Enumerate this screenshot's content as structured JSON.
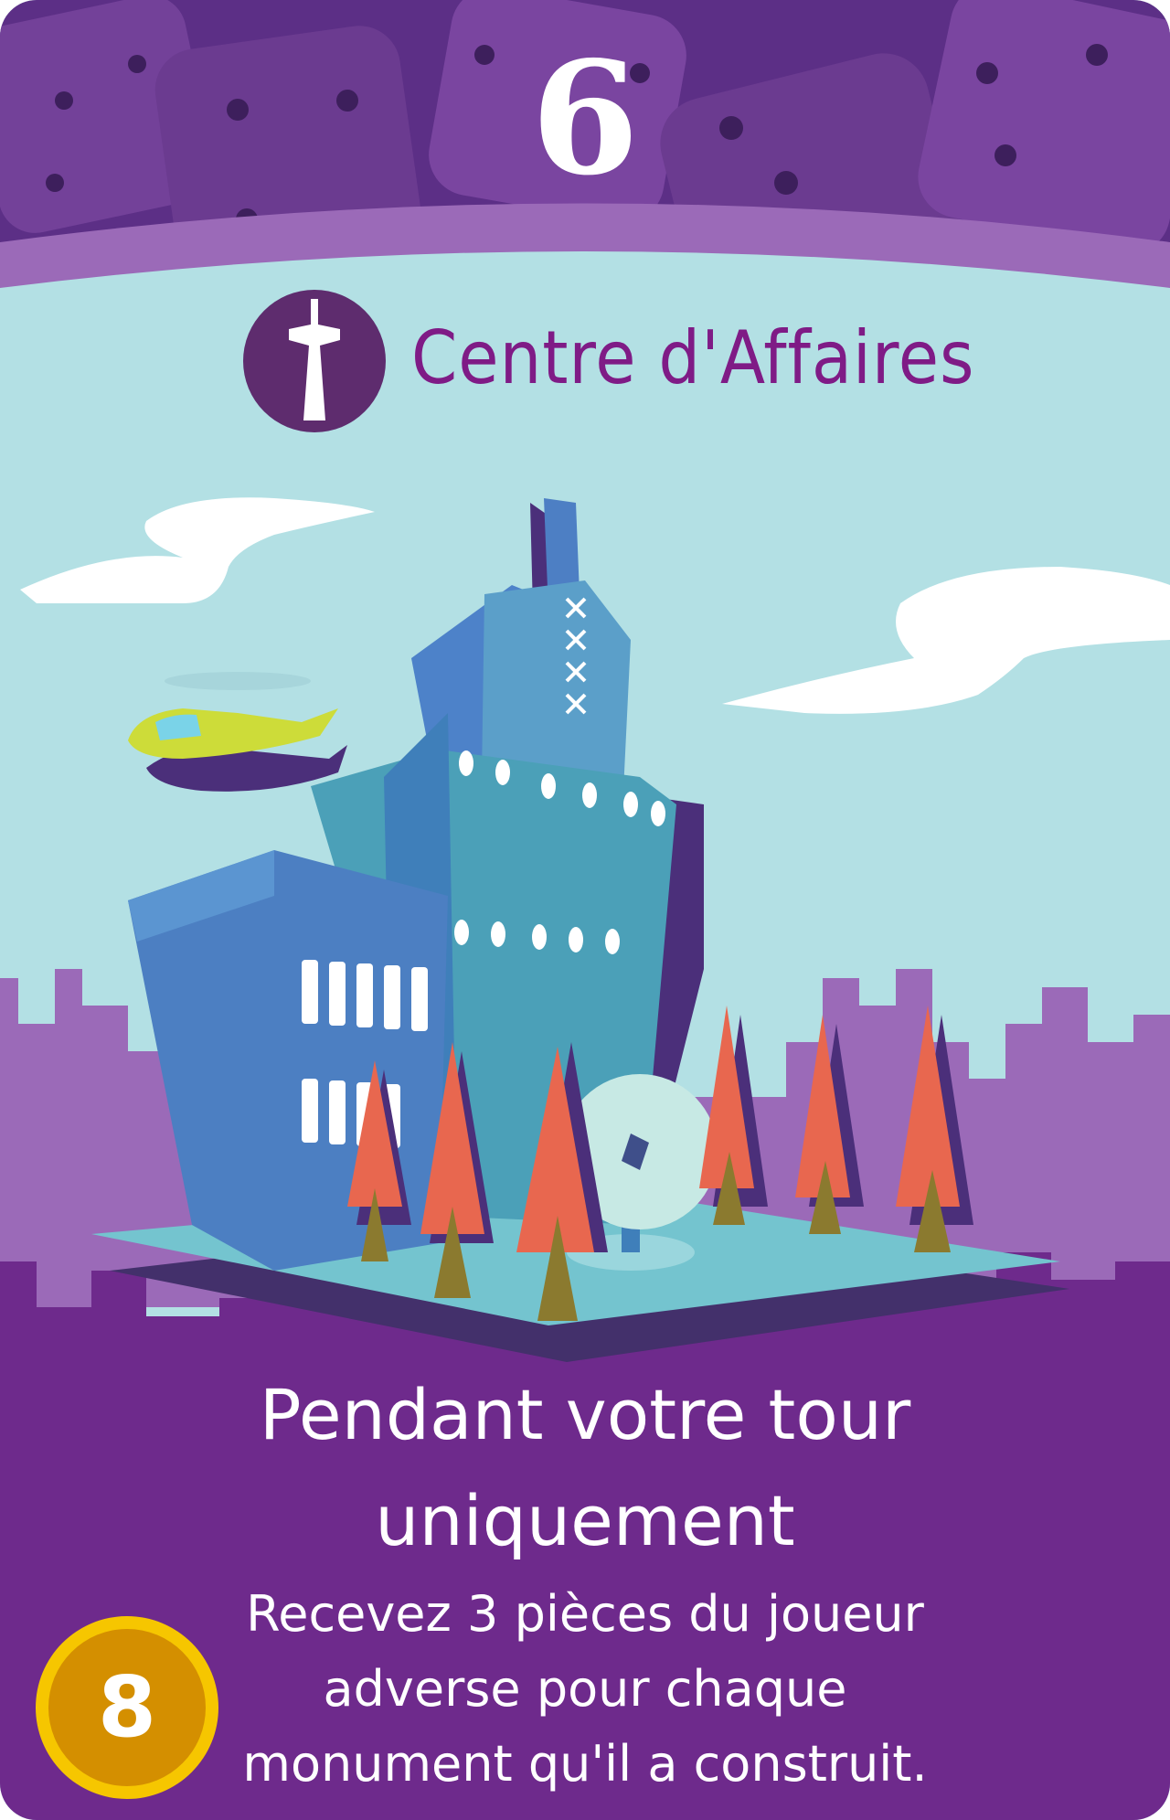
{
  "card": {
    "activation_number": "6",
    "name": "Centre d'Affaires",
    "icon": "tower-icon",
    "rule_title": "Pendant votre tour uniquement",
    "rule_text": "Recevez 3 pièces du joueur adverse pour chaque monument qu'il a construit.",
    "cost": "8"
  },
  "colors": {
    "header": "#5c2f86",
    "band": "#9b6ab8",
    "sky": "#b3e0e4",
    "title": "#7f1b86",
    "footer": "#6e2a8c",
    "coin": "#e2a300"
  }
}
